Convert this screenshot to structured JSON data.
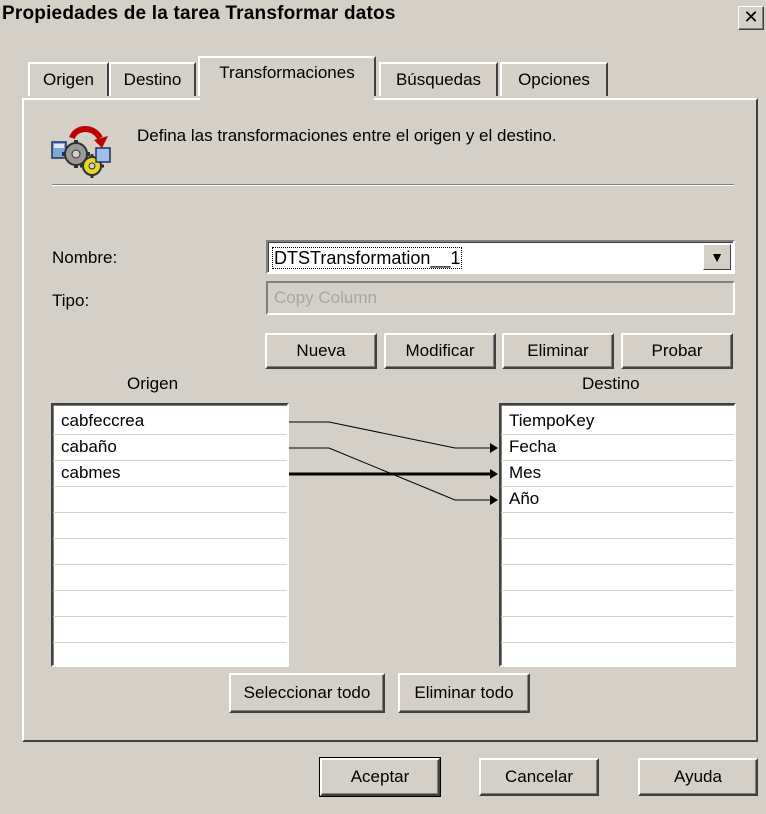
{
  "window": {
    "title": "Propiedades de la tarea Transformar datos",
    "close_glyph": "✕"
  },
  "tabs": [
    {
      "label": "Origen"
    },
    {
      "label": "Destino"
    },
    {
      "label": "Transformaciones"
    },
    {
      "label": "Búsquedas"
    },
    {
      "label": "Opciones"
    }
  ],
  "active_tab": "Transformaciones",
  "description": "Defina las transformaciones entre el origen y el destino.",
  "form": {
    "nombre_label": "Nombre:",
    "nombre_value": "DTSTransformation__1",
    "tipo_label": "Tipo:",
    "tipo_value": "Copy Column"
  },
  "actions": {
    "nueva": "Nueva",
    "modificar": "Modificar",
    "eliminar": "Eliminar",
    "probar": "Probar"
  },
  "source": {
    "header": "Origen",
    "items": [
      "cabfeccrea",
      "cabaño",
      "cabmes"
    ]
  },
  "destination": {
    "header": "Destino",
    "items": [
      "TiempoKey",
      "Fecha",
      "Mes",
      "Año"
    ]
  },
  "mappings": [
    {
      "from": "cabfeccrea",
      "to": "Fecha",
      "selected": false
    },
    {
      "from": "cabaño",
      "to": "Año",
      "selected": false
    },
    {
      "from": "cabmes",
      "to": "Mes",
      "selected": true
    }
  ],
  "list_buttons": {
    "select_all": "Seleccionar todo",
    "delete_all": "Eliminar todo"
  },
  "footer": {
    "ok": "Aceptar",
    "cancel": "Cancelar",
    "help": "Ayuda"
  },
  "icons": {
    "task_icon": "transform-gears-icon",
    "dropdown": "chevron-down-icon"
  },
  "colors": {
    "face": "#d4d0c8",
    "text_disabled": "#a6a6a6"
  }
}
